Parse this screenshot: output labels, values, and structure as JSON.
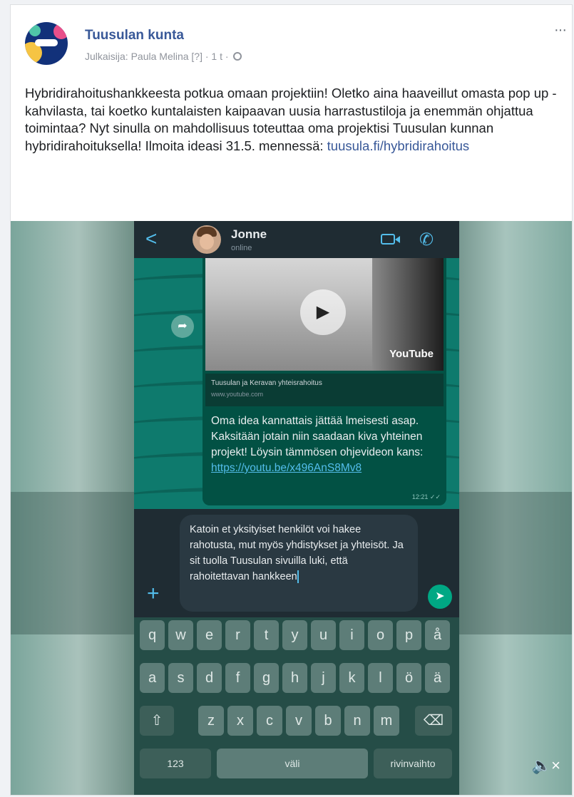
{
  "post": {
    "page_name": "Tuusulan kunta",
    "meta": "Julkaisija: Paula Melina [?] · 1 t ·",
    "more": "···",
    "text": "Hybridirahoitushankkeesta potkua omaan projektiin! Oletko aina haaveillut omasta pop up -kahvilasta, tai koetko kuntalaisten kaipaavan uusia harrastustiloja ja enemmän ohjattua toimintaa? Nyt sinulla on mahdollisuus toteuttaa oma projektisi Tuusulan kunnan hybridirahoituksella! Ilmoita ideasi 31.5. mennessä:",
    "link": "tuusula.fi/hybridirahoitus"
  },
  "video": {
    "chat": {
      "back": "<",
      "contact_name": "Jonne",
      "contact_status": "online",
      "youtube_label": "YouTube",
      "preview_title": "Tuusulan ja Keravan yhteisrahoitus",
      "preview_domain": "www.youtube.com",
      "message": "Oma idea kannattais jättää lmeisesti asap. Kaksitään jotain niin saadaan kiva yhteinen projekt! Löysin tämmösen ohjevideon kans:",
      "message_link": "https://youtu.be/x496AnS8Mv8",
      "message_time": "12:21 ✓✓",
      "input_text": "Katoin et yksityiset henkilöt voi hakee rahotusta, mut myös yhdistykset ja yhteisöt. Ja sit tuolla Tuusulan sivuilla luki, että rahoitettavan hankkeen",
      "plus": "+",
      "send": "➤"
    },
    "keyboard": {
      "row1": [
        "q",
        "w",
        "e",
        "r",
        "t",
        "y",
        "u",
        "i",
        "o",
        "p",
        "å"
      ],
      "row2": [
        "a",
        "s",
        "d",
        "f",
        "g",
        "h",
        "j",
        "k",
        "l",
        "ö",
        "ä"
      ],
      "row3": [
        "z",
        "x",
        "c",
        "v",
        "b",
        "n",
        "m"
      ],
      "shift": "⇧",
      "backspace": "⌫",
      "numbers": "123",
      "space": "väli",
      "return": "rivinvaihto"
    },
    "mute": "🔈×"
  }
}
